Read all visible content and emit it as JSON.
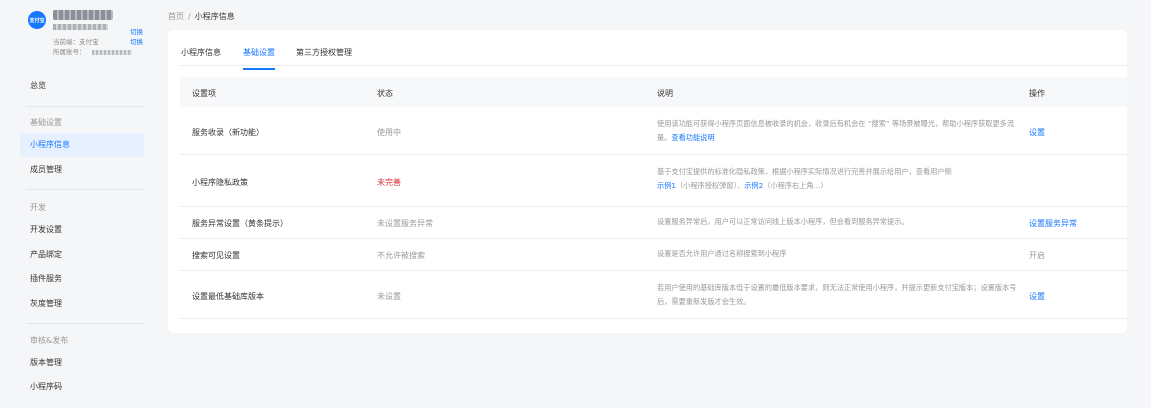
{
  "account": {
    "avatar_text": "支付宝",
    "current_label": "当前端：",
    "current_value": "支付宝",
    "owner_label": "所属账号：",
    "switch_label": "切换"
  },
  "nav": {
    "overview": "总览",
    "group_basic": "基础设置",
    "miniapp_info": "小程序信息",
    "member_mgmt": "成员管理",
    "group_dev": "开发",
    "dev_settings": "开发设置",
    "product_binding": "产品绑定",
    "plugin_service": "插件服务",
    "gray_mgmt": "灰度管理",
    "group_review": "审核&发布",
    "version_mgmt": "版本管理",
    "miniapp_code": "小程序码"
  },
  "breadcrumb": {
    "home": "首页",
    "sep": "/",
    "current": "小程序信息"
  },
  "tabs": [
    {
      "label": "小程序信息"
    },
    {
      "label": "基础设置"
    },
    {
      "label": "第三方授权管理"
    }
  ],
  "table": {
    "headers": {
      "name": "设置项",
      "status": "状态",
      "desc": "说明",
      "op": "操作"
    },
    "rows": [
      {
        "name": "服务收录（新功能）",
        "status": "使用中",
        "desc": "使用该功能可获得小程序页面信息被收录的机会，收录后有机会在 “搜索” 等场景被曝光，帮助小程序获取更多流量。",
        "desc_link": "查看功能说明",
        "op": "设置"
      },
      {
        "name": "小程序隐私政策",
        "status": "未完善",
        "desc": "基于支付宝提供的标准化隐私政策，根据小程序实际情况进行完善并展示给用户，查看用户侧",
        "desc_link1": "示例1",
        "desc_mid1": "（小程序授权弹窗）、",
        "desc_link2": "示例2",
        "desc_mid2": "（小程序右上角...）",
        "op": ""
      },
      {
        "name": "服务异常设置（黄条提示）",
        "status": "未设置服务异常",
        "desc": "设置服务异常后，用户可以正常访问线上版本小程序，但会看到服务异常提示。",
        "op": "设置服务异常"
      },
      {
        "name": "搜索可见设置",
        "status": "不允许被搜索",
        "desc": "设置是否允许用户通过名称搜索到小程序",
        "op": "开启"
      },
      {
        "name": "设置最低基础库版本",
        "status": "未设置",
        "desc": "若用户使用的基础库版本低于设置的最低版本要求，则无法正常使用小程序，并提示更新支付宝版本；设置版本号后，需要重新发版才会生效。",
        "op": "设置"
      }
    ]
  },
  "colors": {
    "accent": "#1677ff",
    "warn": "#d9363e",
    "bg": "#f5f6f8"
  }
}
